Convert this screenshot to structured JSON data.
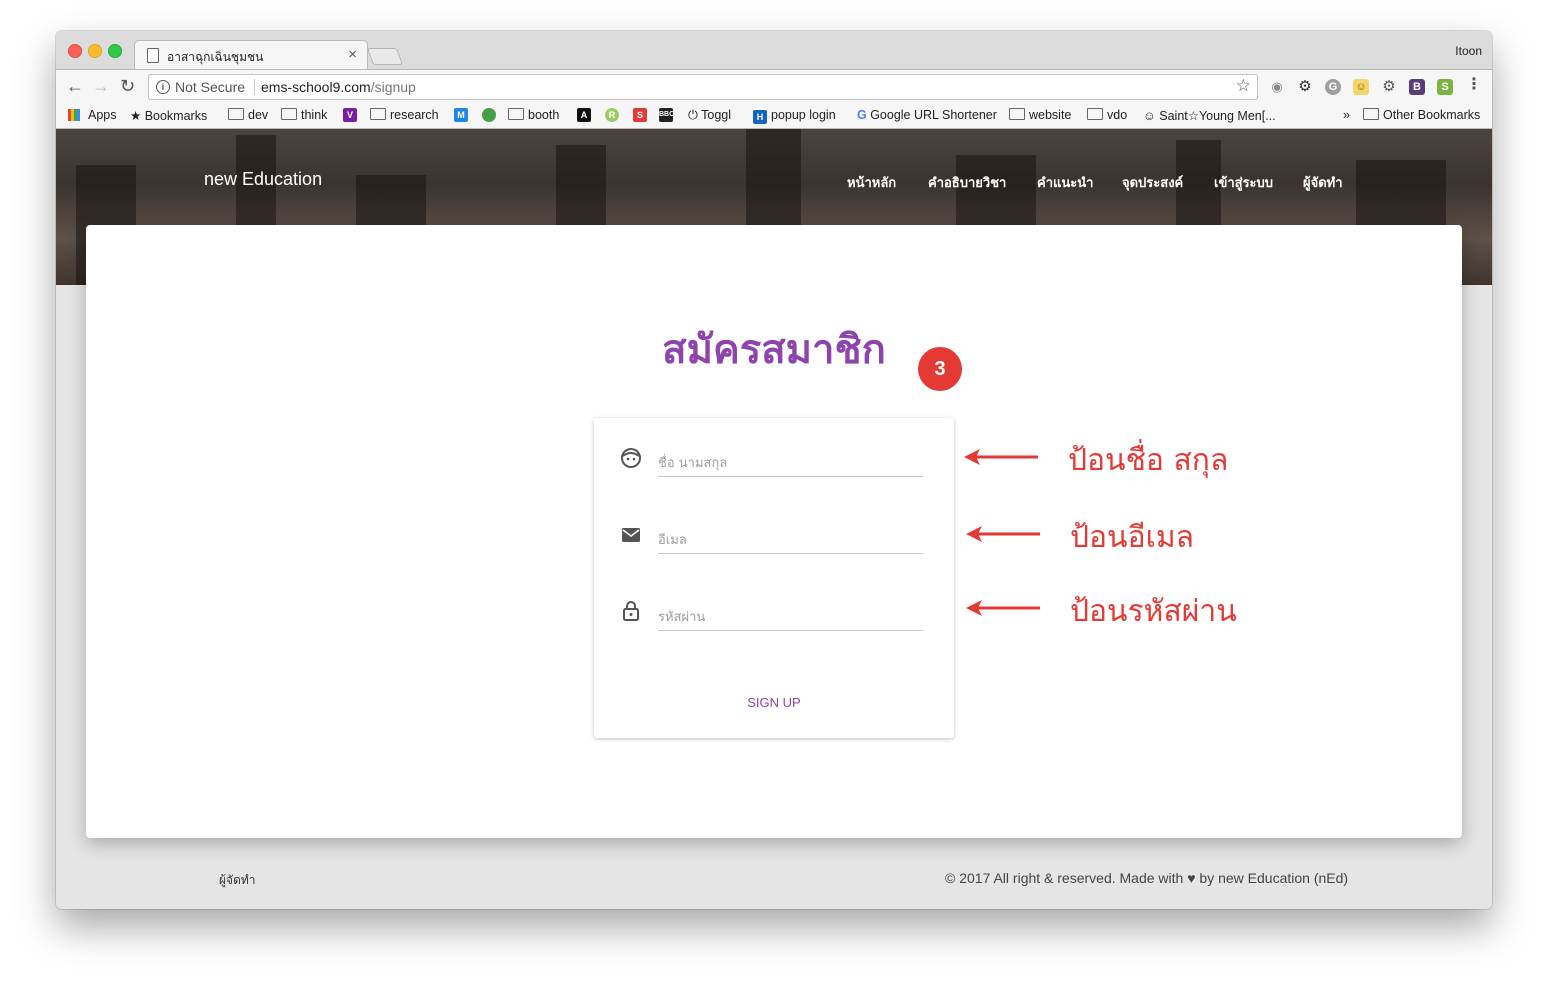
{
  "browser": {
    "tab_title": "อาสาฉุกเฉินชุมชน",
    "tab_close": "×",
    "profile": "Itoon",
    "not_secure": "Not Secure",
    "url_host": "ems-school9.com",
    "url_path": "/signup",
    "bookmarks": [
      "Apps",
      "Bookmarks",
      "dev",
      "think",
      "research",
      "booth",
      "Toggl",
      "popup login",
      "Google URL Shortener",
      "website",
      "vdo",
      "Saint☆Young Men[...",
      "»",
      "Other Bookmarks"
    ]
  },
  "site": {
    "brand": "new Education",
    "nav": [
      "หน้าหลัก",
      "คำอธิบายวิชา",
      "คำแนะนำ",
      "จุดประสงค์",
      "เข้าสู่ระบบ",
      "ผู้จัดทำ"
    ]
  },
  "signup": {
    "title": "สมัครสมาชิก",
    "badge": "3",
    "name_placeholder": "ชื่อ นามสกุล",
    "email_placeholder": "อีเมล",
    "password_placeholder": "รหัสผ่าน",
    "button": "SIGN UP"
  },
  "annotations": [
    "ป้อนชื่อ สกุล",
    "ป้อนอีเมล",
    "ป้อนรหัสผ่าน"
  ],
  "footer": {
    "left": "ผู้จัดทำ",
    "right_prefix": "© 2017 All right & reserved. Made with",
    "heart": "♥",
    "right_suffix": "by new Education (nEd)"
  },
  "colors": {
    "accent_purple": "#8e44ad",
    "annotation_red": "#e53935"
  }
}
